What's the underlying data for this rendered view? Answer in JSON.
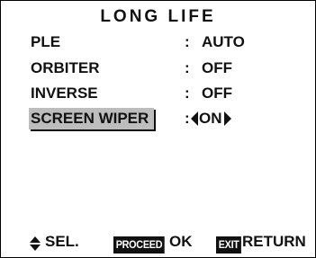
{
  "title": "LONG LIFE",
  "menu": [
    {
      "label": "PLE",
      "colon": ":",
      "value": "AUTO"
    },
    {
      "label": "ORBITER",
      "colon": ":",
      "value": "OFF"
    },
    {
      "label": "INVERSE",
      "colon": ":",
      "value": "OFF"
    },
    {
      "label": "SCREEN WIPER",
      "colon": ":",
      "value": "ON",
      "selected": true
    }
  ],
  "footer": {
    "select_icon": "up-down-arrows-icon",
    "select_label": "SEL.",
    "proceed_key": "PROCEED",
    "proceed_label": "OK",
    "exit_key": "EXIT",
    "exit_label": "RETURN"
  },
  "colors": {
    "background": "#ffffff",
    "text": "#111111",
    "selection_highlight": "#bdbdbd",
    "key_background": "#111111"
  }
}
